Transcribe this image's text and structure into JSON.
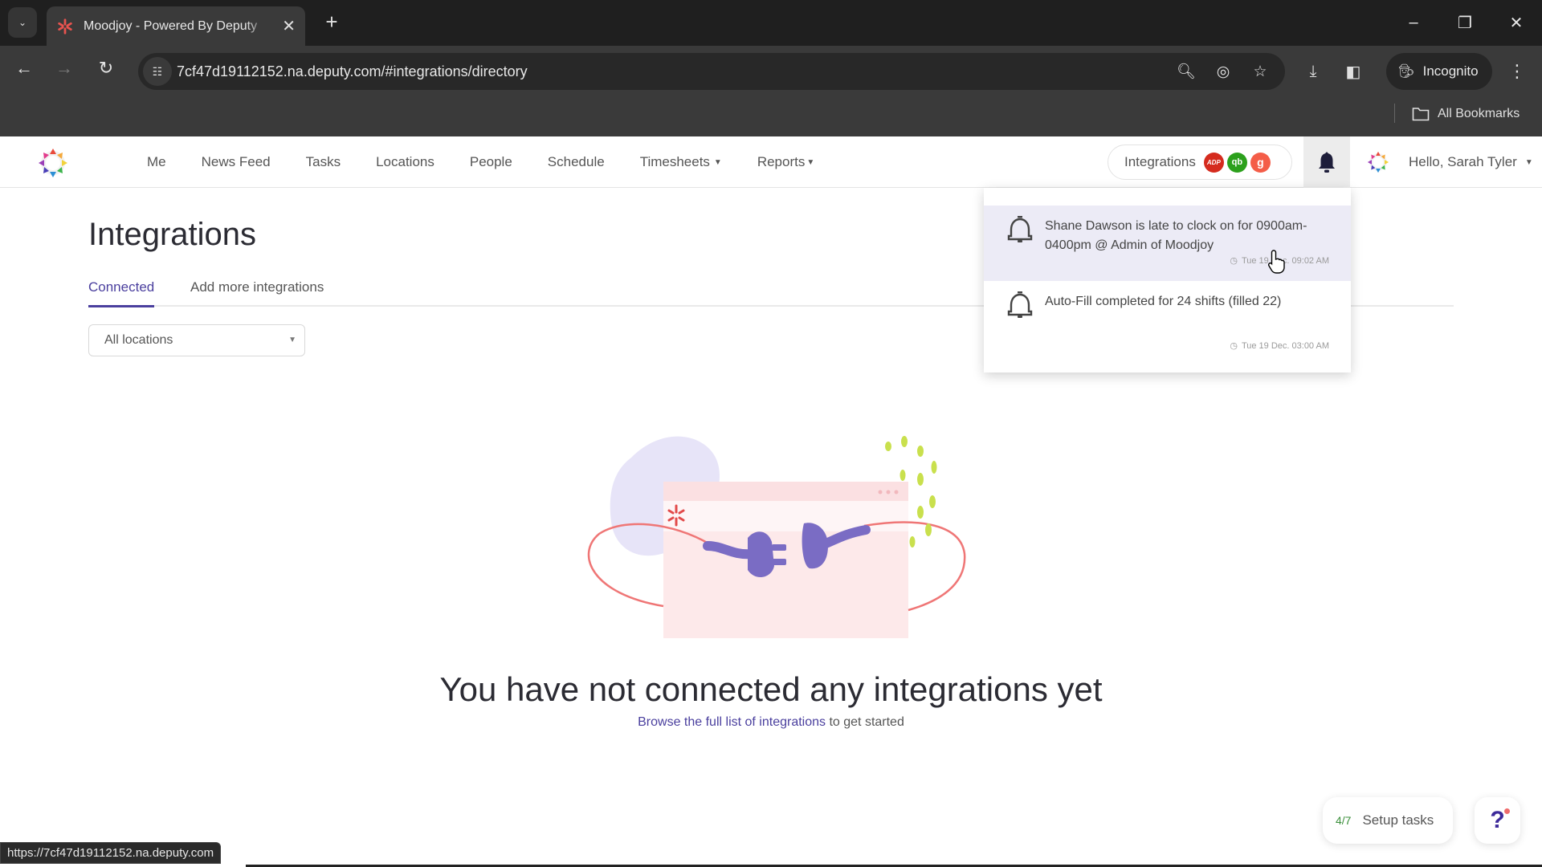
{
  "browser": {
    "tab_title": "Moodjoy - Powered By Deputy",
    "new_tab_label": "+",
    "url": "7cf47d19112152.na.deputy.com/#integrations/directory",
    "incognito_label": "Incognito",
    "bookmarks_label": "All Bookmarks",
    "status_url": "https://7cf47d19112152.na.deputy.com"
  },
  "nav": {
    "links": [
      {
        "label": "Me"
      },
      {
        "label": "News Feed"
      },
      {
        "label": "Tasks"
      },
      {
        "label": "Locations"
      },
      {
        "label": "People"
      },
      {
        "label": "Schedule"
      },
      {
        "label": "Timesheets",
        "dropdown": true
      },
      {
        "label": "Reports",
        "dropdown": true
      }
    ],
    "integrations_label": "Integrations",
    "integration_badges": [
      {
        "name": "adp",
        "text": "ADP",
        "color": "#d52b1e"
      },
      {
        "name": "quickbooks",
        "text": "qb",
        "color": "#2ca01c"
      },
      {
        "name": "gusto",
        "text": "g",
        "color": "#f45d48"
      }
    ],
    "greeting": "Hello, Sarah Tyler"
  },
  "page": {
    "title": "Integrations",
    "tabs": [
      {
        "label": "Connected",
        "active": true
      },
      {
        "label": "Add more integrations",
        "active": false
      }
    ],
    "location_filter": {
      "selected": "All locations"
    },
    "empty_state": {
      "title": "You have not connected any integrations yet",
      "link_text": "Browse the full list of integrations",
      "suffix": " to get started"
    }
  },
  "notifications": [
    {
      "message": "Shane Dawson is late to clock on for 0900am-0400pm @ Admin of Moodjoy",
      "time": "Tue 19 Dec. 09:02 AM"
    },
    {
      "message": "Auto-Fill completed for 24 shifts (filled 22)",
      "time": "Tue 19 Dec. 03:00 AM"
    }
  ],
  "setup_tasks": {
    "progress": "4/7",
    "label": "Setup tasks"
  },
  "help": {
    "label": "?"
  },
  "colors": {
    "accent": "#4a3f9e",
    "notification_hover": "#ecebf6",
    "setup_progress": "#3a8f3a"
  }
}
